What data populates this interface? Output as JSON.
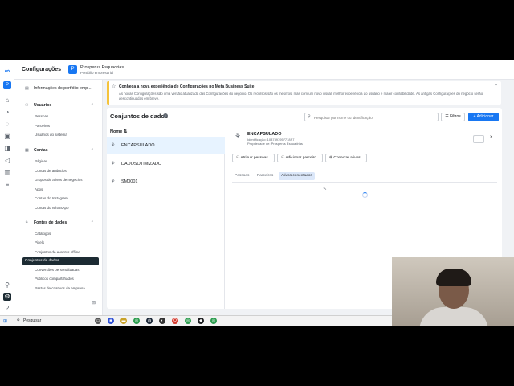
{
  "app": {
    "title": "Configurações",
    "portfolio_initial": "P",
    "portfolio_name": "Prosperus Esquadrias",
    "portfolio_type": "Portfólio empresarial"
  },
  "sidebar": {
    "info": "Informações do portfólio emp...",
    "users_header": "Usuários",
    "users_items": [
      "Pessoas",
      "Parceiros",
      "Usuários do sistema"
    ],
    "accounts_header": "Contas",
    "accounts_items": [
      "Páginas",
      "Contas de anúncios",
      "Grupos de ativos de negócios",
      "Apps",
      "Contas do Instagram",
      "Contas do WhatsApp"
    ],
    "datasources_header": "Fontes de dados",
    "datasources_items": [
      "Catálogos",
      "Pixels",
      "Conjuntos de eventos offline",
      "Conjuntos de dados",
      "Conversões personalizadas",
      "Públicos compartilhados",
      "Pastas de criativos da empresa"
    ],
    "active_item": "Conjuntos de dados"
  },
  "banner": {
    "title": "Conheça a nova experiência de Configurações no Meta Business Suite",
    "text": "As novas Configurações são uma versão atualizada das Configurações do negócio. Os recursos são os mesmos, mas com um novo visual, melhor experiência do usuário e maior confiabilidade. As antigas Configurações do negócio serão descontinuadas em breve."
  },
  "panel": {
    "title": "Conjuntos de dados",
    "search_placeholder": "Pesquisar por nome ou identificação",
    "filters_label": "Filtros",
    "add_label": "+ Adicionar",
    "column_name": "Nome ⇅",
    "rows": [
      "ENCAPSULADO",
      "DADOSOTIMIZADO",
      "SM0001"
    ],
    "selected_row": "ENCAPSULADO"
  },
  "detail": {
    "name": "ENCAPSULADO",
    "id_text": "Identificação: 1087397957718S7",
    "owner_text": "Propriedade de: Prosperus Esquadrias",
    "more_label": "···",
    "close_label": "×",
    "actions": [
      "Atribuir pessoas",
      "Adicionar parceiro",
      "Conectar ativos"
    ],
    "tabs": [
      "Pessoas",
      "Parceiros",
      "Ativos conectados"
    ],
    "active_tab": "Ativos conectados"
  },
  "taskbar": {
    "search_label": "Pesquisar"
  },
  "colors": {
    "accent": "#1877f2",
    "banner_border": "#f5c33b",
    "active_nav": "#1c2b33"
  }
}
